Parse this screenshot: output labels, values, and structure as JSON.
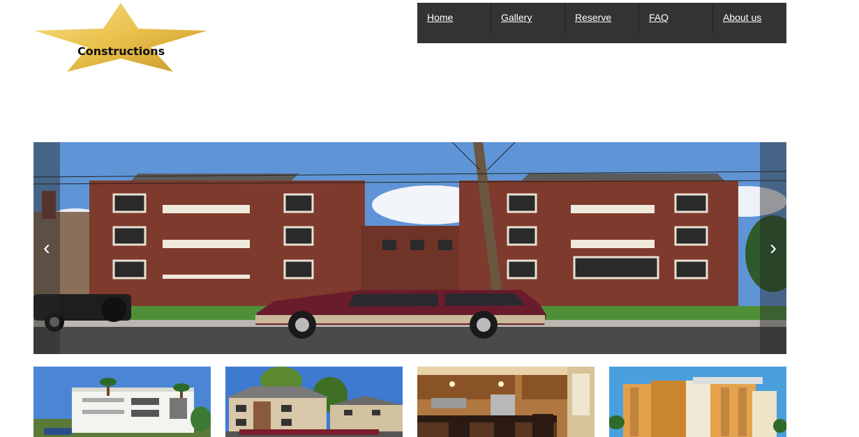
{
  "logo": {
    "text": "Constructions",
    "star_color": "#e9c04a"
  },
  "nav": {
    "background": "#333333",
    "items": [
      {
        "label": "Home"
      },
      {
        "label": "Gallery"
      },
      {
        "label": "Reserve"
      },
      {
        "label": "FAQ"
      },
      {
        "label": "About us"
      }
    ]
  },
  "slider": {
    "prev_icon": "‹",
    "next_icon": "›",
    "image": "apartment-building-with-maroon-suv"
  },
  "thumbnails": [
    {
      "image": "white-modern-apartment-building"
    },
    {
      "image": "suburban-apartment-complex"
    },
    {
      "image": "apartment-kitchen-interior"
    },
    {
      "image": "orange-highrise-apartment-tower"
    }
  ]
}
